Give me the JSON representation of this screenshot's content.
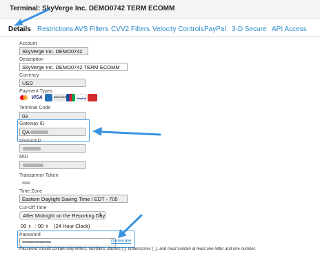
{
  "header": {
    "title": "Terminal: SkyVerge Inc. DEMO0742 TERM ECOMM"
  },
  "tabs": [
    {
      "label": "Details",
      "active": true
    },
    {
      "label": "Restrictions"
    },
    {
      "label": "AVS Filters"
    },
    {
      "label": "CVV2 Filters"
    },
    {
      "label": "Velocity Controls"
    },
    {
      "label": "PayPal"
    },
    {
      "label": "3-D Secure"
    },
    {
      "label": "API Access"
    }
  ],
  "fields": {
    "account": {
      "label": "Account",
      "value": "SkyVerge Inc. DEMO0742"
    },
    "description": {
      "label": "Description",
      "value": "SkyVerge Inc. DEMO0742 TERM ECOMM"
    },
    "currency": {
      "label": "Currency",
      "value": "USD"
    },
    "payment_types": {
      "label": "Payment Types",
      "cards": [
        "mastercard-icon",
        "visa-icon",
        "amex-icon",
        "discover-icon",
        "jcb-icon",
        "paypal-icon",
        "paypal-credit-icon"
      ]
    },
    "terminal_code": {
      "label": "Terminal Code",
      "value": "03"
    },
    "gateway_id": {
      "label": "Gateway ID",
      "value": "QA"
    },
    "division_id": {
      "label": "DivisionID"
    },
    "mid": {
      "label": "MID"
    },
    "transarmor_token": {
      "label": "Transarmor Token"
    },
    "time_zone": {
      "label": "Time Zone",
      "value": "Eastern Daylight Saving Time / EDT - 705"
    },
    "cutoff": {
      "label": "Cut-Off Time",
      "value": "After Midnight on the Reporting Day",
      "hour": "00",
      "minute": "00",
      "clock_note": "(24 Hour Clock)"
    },
    "password": {
      "label": "Password",
      "value": "••••••••••••••••••••••••••",
      "generate_label": "Generate",
      "hint": "Password should contain only letters, numbers, dashes (-), underscores (_), and must contain at least one letter and one number."
    }
  },
  "colors": {
    "accent": "#2a8ac8",
    "highlight": "#4a9fe3"
  }
}
